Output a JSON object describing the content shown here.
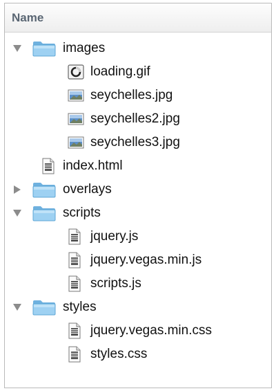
{
  "header": {
    "column_label": "Name"
  },
  "tree": [
    {
      "label": "images",
      "type": "folder",
      "icon": "folder-icon",
      "expanded": true,
      "depth": 0
    },
    {
      "label": "loading.gif",
      "type": "file",
      "icon": "gif-image-icon",
      "depth": 1
    },
    {
      "label": "seychelles.jpg",
      "type": "file",
      "icon": "jpg-image-icon",
      "depth": 1
    },
    {
      "label": "seychelles2.jpg",
      "type": "file",
      "icon": "jpg-image-icon",
      "depth": 1
    },
    {
      "label": "seychelles3.jpg",
      "type": "file",
      "icon": "jpg-image-icon",
      "depth": 1
    },
    {
      "label": "index.html",
      "type": "file",
      "icon": "document-icon",
      "depth": 0
    },
    {
      "label": "overlays",
      "type": "folder",
      "icon": "folder-icon",
      "expanded": false,
      "depth": 0
    },
    {
      "label": "scripts",
      "type": "folder",
      "icon": "folder-icon",
      "expanded": true,
      "depth": 0
    },
    {
      "label": "jquery.js",
      "type": "file",
      "icon": "document-icon",
      "depth": 1
    },
    {
      "label": "jquery.vegas.min.js",
      "type": "file",
      "icon": "document-icon",
      "depth": 1
    },
    {
      "label": "scripts.js",
      "type": "file",
      "icon": "document-icon",
      "depth": 1
    },
    {
      "label": "styles",
      "type": "folder",
      "icon": "folder-icon",
      "expanded": true,
      "depth": 0
    },
    {
      "label": "jquery.vegas.min.css",
      "type": "file",
      "icon": "document-icon",
      "depth": 1
    },
    {
      "label": "styles.css",
      "type": "file",
      "icon": "document-icon",
      "depth": 1
    }
  ],
  "colors": {
    "folder_blue": "#8cc7ee",
    "folder_tab": "#6fb1df",
    "header_text": "#5a6673",
    "disclosure_gray": "#8c8c8c"
  }
}
